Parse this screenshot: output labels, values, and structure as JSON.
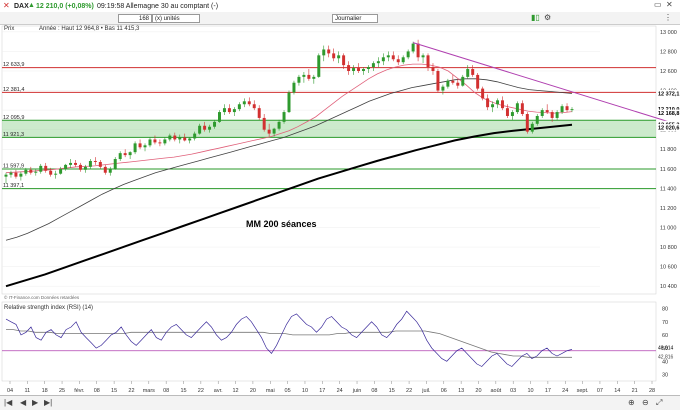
{
  "header": {
    "symbol": "DAX",
    "quote": "12 210,0 (+0,08%)",
    "time_text": "09:19:58 Allemagne 30 au comptant (-)",
    "quantity": "168",
    "unit": "(x) unités",
    "period": "Journalier"
  },
  "info": {
    "label": "Prix",
    "year_stats": "Année : Haut 12 964,8 • Bas 11 415,3"
  },
  "source_text": "© IT-Finance.com Données retardées",
  "rsi_title": "Relative strength index (RSI) (14)",
  "annotation": "MM 200 séances",
  "colors": {
    "up": "#2e9a2e",
    "down": "#d23030",
    "ma20": "#e0607a",
    "ma50": "#404040",
    "ma200": "#000000",
    "resistance": "#d03030",
    "support": "#2a9a2a",
    "zone": "#8fd08f",
    "trend": "#b040b0"
  },
  "chart_data": {
    "type": "candlestick",
    "title": "DAX",
    "y_ticks": [
      10400,
      10600,
      10800,
      11000,
      11200,
      11400,
      11600,
      11800,
      12000,
      12200,
      12400,
      12600,
      12800,
      13000
    ],
    "x_ticks": [
      "04",
      "11",
      "18",
      "25",
      "févr.",
      "08",
      "15",
      "22",
      "mars",
      "08",
      "15",
      "22",
      "avr.",
      "12",
      "20",
      "mai",
      "05",
      "10",
      "17",
      "24",
      "juin",
      "08",
      "15",
      "22",
      "juil.",
      "06",
      "13",
      "20",
      "août",
      "03",
      "10",
      "17",
      "24",
      "sept.",
      "07",
      "14",
      "21",
      "28"
    ],
    "ylim": [
      10320,
      13060
    ],
    "candles": [
      [
        11520,
        11560,
        11450,
        11540
      ],
      [
        11540,
        11580,
        11510,
        11560
      ],
      [
        11560,
        11590,
        11500,
        11520
      ],
      [
        11520,
        11570,
        11480,
        11550
      ],
      [
        11550,
        11610,
        11530,
        11590
      ],
      [
        11590,
        11620,
        11540,
        11560
      ],
      [
        11560,
        11600,
        11530,
        11570
      ],
      [
        11570,
        11650,
        11550,
        11630
      ],
      [
        11630,
        11660,
        11560,
        11580
      ],
      [
        11580,
        11610,
        11520,
        11540
      ],
      [
        11540,
        11580,
        11500,
        11550
      ],
      [
        11550,
        11620,
        11540,
        11600
      ],
      [
        11600,
        11650,
        11580,
        11640
      ],
      [
        11640,
        11700,
        11610,
        11660
      ],
      [
        11660,
        11690,
        11620,
        11640
      ],
      [
        11640,
        11660,
        11570,
        11590
      ],
      [
        11590,
        11640,
        11560,
        11620
      ],
      [
        11620,
        11700,
        11600,
        11680
      ],
      [
        11680,
        11720,
        11640,
        11670
      ],
      [
        11670,
        11690,
        11600,
        11620
      ],
      [
        11620,
        11640,
        11540,
        11560
      ],
      [
        11560,
        11620,
        11530,
        11600
      ],
      [
        11600,
        11720,
        11590,
        11700
      ],
      [
        11700,
        11780,
        11680,
        11760
      ],
      [
        11760,
        11800,
        11720,
        11740
      ],
      [
        11740,
        11780,
        11700,
        11770
      ],
      [
        11770,
        11880,
        11750,
        11860
      ],
      [
        11860,
        11900,
        11800,
        11820
      ],
      [
        11820,
        11860,
        11780,
        11840
      ],
      [
        11840,
        11920,
        11820,
        11900
      ],
      [
        11900,
        11940,
        11850,
        11870
      ],
      [
        11870,
        11900,
        11830,
        11860
      ],
      [
        11860,
        11920,
        11840,
        11900
      ],
      [
        11900,
        11960,
        11880,
        11940
      ],
      [
        11940,
        11970,
        11880,
        11900
      ],
      [
        11900,
        11950,
        11860,
        11920
      ],
      [
        11920,
        11960,
        11880,
        11890
      ],
      [
        11890,
        11920,
        11860,
        11910
      ],
      [
        11910,
        11980,
        11890,
        11960
      ],
      [
        11960,
        12060,
        11950,
        12040
      ],
      [
        12040,
        12080,
        11980,
        12000
      ],
      [
        12000,
        12050,
        11970,
        12030
      ],
      [
        12030,
        12100,
        12010,
        12080
      ],
      [
        12080,
        12200,
        12070,
        12180
      ],
      [
        12180,
        12260,
        12150,
        12220
      ],
      [
        12220,
        12260,
        12160,
        12180
      ],
      [
        12180,
        12230,
        12140,
        12210
      ],
      [
        12210,
        12280,
        12190,
        12260
      ],
      [
        12260,
        12320,
        12230,
        12290
      ],
      [
        12290,
        12330,
        12240,
        12260
      ],
      [
        12260,
        12300,
        12200,
        12220
      ],
      [
        12220,
        12250,
        12100,
        12120
      ],
      [
        12120,
        12160,
        11980,
        12000
      ],
      [
        12000,
        12060,
        11930,
        11960
      ],
      [
        11960,
        12020,
        11930,
        12010
      ],
      [
        12010,
        12100,
        11990,
        12080
      ],
      [
        12080,
        12200,
        12060,
        12180
      ],
      [
        12180,
        12400,
        12170,
        12380
      ],
      [
        12380,
        12500,
        12360,
        12480
      ],
      [
        12480,
        12560,
        12450,
        12540
      ],
      [
        12540,
        12590,
        12480,
        12560
      ],
      [
        12560,
        12620,
        12500,
        12520
      ],
      [
        12520,
        12560,
        12470,
        12540
      ],
      [
        12540,
        12780,
        12530,
        12760
      ],
      [
        12760,
        12860,
        12700,
        12820
      ],
      [
        12820,
        12860,
        12740,
        12780
      ],
      [
        12780,
        12830,
        12700,
        12730
      ],
      [
        12730,
        12800,
        12680,
        12760
      ],
      [
        12760,
        12780,
        12620,
        12660
      ],
      [
        12660,
        12700,
        12560,
        12600
      ],
      [
        12600,
        12660,
        12560,
        12630
      ],
      [
        12630,
        12680,
        12580,
        12600
      ],
      [
        12600,
        12640,
        12560,
        12620
      ],
      [
        12620,
        12660,
        12580,
        12640
      ],
      [
        12640,
        12700,
        12600,
        12680
      ],
      [
        12680,
        12740,
        12640,
        12700
      ],
      [
        12700,
        12780,
        12660,
        12740
      ],
      [
        12740,
        12800,
        12700,
        12760
      ],
      [
        12760,
        12800,
        12700,
        12720
      ],
      [
        12720,
        12760,
        12660,
        12690
      ],
      [
        12690,
        12760,
        12670,
        12740
      ],
      [
        12740,
        12820,
        12720,
        12800
      ],
      [
        12800,
        12900,
        12780,
        12880
      ],
      [
        12880,
        12920,
        12700,
        12740
      ],
      [
        12740,
        12780,
        12680,
        12760
      ],
      [
        12760,
        12780,
        12600,
        12640
      ],
      [
        12640,
        12680,
        12560,
        12600
      ],
      [
        12600,
        12620,
        12380,
        12400
      ],
      [
        12400,
        12460,
        12360,
        12440
      ],
      [
        12440,
        12520,
        12420,
        12500
      ],
      [
        12500,
        12560,
        12460,
        12480
      ],
      [
        12480,
        12520,
        12420,
        12450
      ],
      [
        12450,
        12560,
        12440,
        12540
      ],
      [
        12540,
        12660,
        12520,
        12620
      ],
      [
        12620,
        12660,
        12540,
        12560
      ],
      [
        12560,
        12580,
        12400,
        12420
      ],
      [
        12420,
        12440,
        12300,
        12320
      ],
      [
        12320,
        12360,
        12200,
        12230
      ],
      [
        12230,
        12290,
        12180,
        12260
      ],
      [
        12260,
        12320,
        12220,
        12300
      ],
      [
        12300,
        12340,
        12200,
        12220
      ],
      [
        12220,
        12260,
        12120,
        12140
      ],
      [
        12140,
        12200,
        12100,
        12180
      ],
      [
        12180,
        12290,
        12160,
        12270
      ],
      [
        12270,
        12300,
        12140,
        12160
      ],
      [
        12160,
        12180,
        11960,
        11980
      ],
      [
        11980,
        12080,
        11960,
        12060
      ],
      [
        12060,
        12160,
        12040,
        12140
      ],
      [
        12140,
        12220,
        12120,
        12200
      ],
      [
        12200,
        12260,
        12160,
        12180
      ],
      [
        12180,
        12200,
        12080,
        12120
      ],
      [
        12120,
        12200,
        12100,
        12180
      ],
      [
        12180,
        12260,
        12160,
        12240
      ],
      [
        12240,
        12270,
        12180,
        12200
      ],
      [
        12200,
        12230,
        12180,
        12210
      ]
    ],
    "ma20": [
      11560,
      11565,
      11570,
      11575,
      11585,
      11590,
      11600,
      11610,
      11620,
      11625,
      11630,
      11640,
      11650,
      11660,
      11670,
      11680,
      11690,
      11700,
      11710,
      11720,
      11735,
      11750,
      11770,
      11790,
      11810,
      11830,
      11850,
      11870,
      11890,
      11910,
      11930,
      11960,
      11990,
      12030,
      12080,
      12130,
      12200,
      12270,
      12340,
      12400,
      12460,
      12520,
      12570,
      12610,
      12640,
      12660,
      12670,
      12670,
      12660,
      12640,
      12600,
      12530,
      12460,
      12380,
      12320,
      12280,
      12250,
      12230,
      12210,
      12190,
      12180,
      12175,
      12170,
      12175,
      12185
    ],
    "ma50": [
      10870,
      10900,
      10940,
      10990,
      11040,
      11100,
      11160,
      11220,
      11280,
      11340,
      11390,
      11440,
      11480,
      11520,
      11560,
      11590,
      11620,
      11650,
      11680,
      11710,
      11740,
      11770,
      11800,
      11830,
      11860,
      11890,
      11920,
      11960,
      12000,
      12040,
      12090,
      12140,
      12190,
      12240,
      12290,
      12330,
      12370,
      12400,
      12430,
      12450,
      12470,
      12490,
      12510,
      12520,
      12520,
      12510,
      12490,
      12460,
      12430,
      12410,
      12400,
      12390,
      12380,
      12370
    ],
    "ma200": [
      10400,
      10460,
      10520,
      10590,
      10660,
      10730,
      10800,
      10870,
      10940,
      11010,
      11080,
      11150,
      11220,
      11290,
      11360,
      11430,
      11500,
      11560,
      11620,
      11680,
      11735,
      11790,
      11840,
      11890,
      11930,
      11965,
      11990,
      12010,
      12030,
      12050
    ],
    "horizontal_levels": [
      {
        "label": "12 633,9",
        "value": 12634,
        "color": "resistance"
      },
      {
        "label": "12 381,4",
        "value": 12381,
        "color": "resistance"
      },
      {
        "label": "12 095,9",
        "value": 12096,
        "color": "support"
      },
      {
        "label": "11 921,3",
        "value": 11921,
        "color": "support"
      },
      {
        "label": "11 597,9",
        "value": 11598,
        "color": "support"
      },
      {
        "label": "11 397,1",
        "value": 11397,
        "color": "support"
      }
    ],
    "support_zone": [
      11921,
      12096
    ],
    "price_labels": [
      {
        "label": "12 372,1",
        "value": 12372
      },
      {
        "label": "12 210,0",
        "value": 12210
      },
      {
        "label": "12 168,8",
        "value": 12169
      },
      {
        "label": "12 055,2",
        "value": 12055
      },
      {
        "label": "12 020,6",
        "value": 12021
      }
    ],
    "trendline": [
      [
        12890,
        82
      ],
      [
        11900,
        145
      ]
    ],
    "rsi": {
      "ylim": [
        25,
        85
      ],
      "y_ticks": [
        30,
        40,
        50,
        60,
        70,
        80
      ],
      "level": 48,
      "value_labels": [
        "48,914",
        "42,816"
      ],
      "values": [
        72,
        70,
        68,
        60,
        62,
        66,
        58,
        56,
        62,
        64,
        60,
        58,
        64,
        66,
        70,
        62,
        58,
        54,
        50,
        52,
        56,
        60,
        62,
        66,
        60,
        55,
        52,
        56,
        60,
        64,
        58,
        56,
        62,
        66,
        68,
        64,
        60,
        58,
        62,
        66,
        70,
        66,
        60,
        56,
        58,
        62,
        68,
        72,
        74,
        70,
        64,
        58,
        50,
        46,
        52,
        60,
        68,
        74,
        76,
        72,
        68,
        66,
        62,
        66,
        72,
        74,
        70,
        66,
        64,
        60,
        58,
        62,
        66,
        70,
        66,
        60,
        58,
        62,
        68,
        72,
        78,
        74,
        70,
        64,
        56,
        50,
        46,
        42,
        40,
        44,
        48,
        50,
        46,
        42,
        38,
        36,
        40,
        44,
        46,
        42,
        38,
        36,
        40,
        44,
        46,
        42,
        44,
        48,
        50,
        46,
        44,
        46,
        48,
        49
      ],
      "signal": [
        64,
        64,
        63,
        63,
        62,
        62,
        62,
        61,
        61,
        61,
        61,
        61,
        61,
        61,
        61,
        61,
        61,
        62,
        62,
        62,
        62,
        62,
        62,
        62,
        62,
        62,
        62,
        62,
        62,
        62,
        62,
        62,
        62,
        62,
        62,
        62,
        61,
        61,
        61,
        60,
        60,
        60,
        60,
        60,
        60,
        61,
        61,
        62,
        62,
        62,
        62,
        62,
        62,
        63,
        63,
        63,
        63,
        63,
        62,
        61,
        59,
        57,
        55,
        53,
        51,
        49,
        47,
        46,
        45,
        44,
        44,
        43,
        43,
        43,
        43,
        43,
        43,
        43
      ]
    }
  }
}
